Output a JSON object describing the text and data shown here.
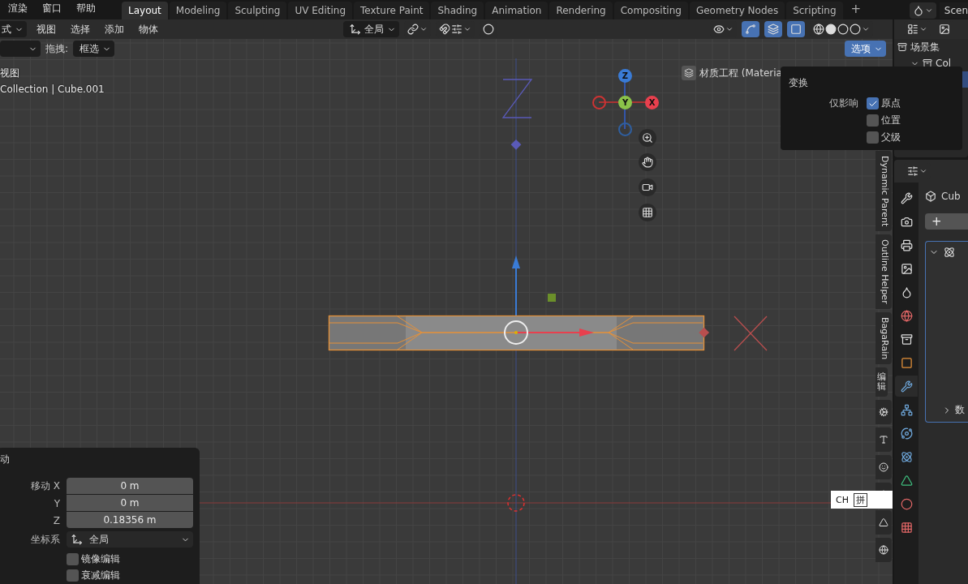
{
  "menu": [
    {
      "label": "渲染"
    },
    {
      "label": "窗口"
    },
    {
      "label": "帮助"
    }
  ],
  "workspace_tabs": [
    {
      "label": "Layout",
      "selected": true
    },
    {
      "label": "Modeling",
      "selected": false
    },
    {
      "label": "Sculpting",
      "selected": false
    },
    {
      "label": "UV Editing",
      "selected": false
    },
    {
      "label": "Texture Paint",
      "selected": false
    },
    {
      "label": "Shading",
      "selected": false
    },
    {
      "label": "Animation",
      "selected": false
    },
    {
      "label": "Rendering",
      "selected": false
    },
    {
      "label": "Compositing",
      "selected": false
    },
    {
      "label": "Geometry Nodes",
      "selected": false
    },
    {
      "label": "Scripting",
      "selected": false
    }
  ],
  "add_tab": "+",
  "scene": "Scen",
  "viewport": {
    "header": {
      "mode": "式",
      "menus": [
        "视图",
        "选择",
        "添加",
        "物体"
      ],
      "orientation": "全局"
    },
    "tool_header": {
      "drag_label": "拖拽:",
      "drag_value": "框选",
      "options": "选项"
    },
    "view_name": "视图",
    "object_path": "Collection | Cube.001",
    "breadcrumb": "材质工程 (Materia",
    "gizmo": {
      "z": "Z",
      "y": "Y",
      "x": "X"
    },
    "popover": {
      "title": "变换",
      "label": "仅影响",
      "options": [
        {
          "label": "原点",
          "checked": true
        },
        {
          "label": "位置",
          "checked": false
        },
        {
          "label": "父级",
          "checked": false
        }
      ]
    },
    "operator": {
      "title": "动",
      "fields": [
        {
          "label": "移动 X",
          "value": "0 m"
        },
        {
          "label": "Y",
          "value": "0 m"
        },
        {
          "label": "Z",
          "value": "0.18356 m"
        }
      ],
      "orientation_label": "坐标系",
      "orientation": "全局",
      "toggles": [
        {
          "label": "镜像编辑",
          "checked": false
        },
        {
          "label": "衰减编辑",
          "checked": false
        }
      ]
    },
    "ime": {
      "lang": "CH",
      "mode": "拼"
    }
  },
  "sidebar_tabs": [
    {
      "label": "Dynamic Parent",
      "kind": "latin"
    },
    {
      "label": "Outline Helper",
      "kind": "latin"
    },
    {
      "label": "BagaRain",
      "kind": "latin"
    },
    {
      "label": "编辑",
      "kind": "cjk"
    }
  ],
  "outliner": {
    "rows": [
      {
        "label": "场景集",
        "selected": false
      },
      {
        "label": "Col",
        "selected": false
      },
      {
        "selected": true
      }
    ]
  },
  "properties_tabs": [
    {
      "selected": false
    },
    {
      "selected": false
    },
    {
      "selected": false
    },
    {
      "selected": false
    },
    {
      "selected": false
    },
    {
      "selected": false
    },
    {
      "selected": false
    },
    {
      "selected": false
    },
    {
      "selected": true
    },
    {
      "selected": false
    },
    {
      "selected": false
    },
    {
      "selected": false
    },
    {
      "selected": false
    },
    {
      "selected": false
    },
    {
      "selected": false
    }
  ],
  "properties": {
    "object": "Cub",
    "add": "+",
    "panel_row": "数"
  }
}
